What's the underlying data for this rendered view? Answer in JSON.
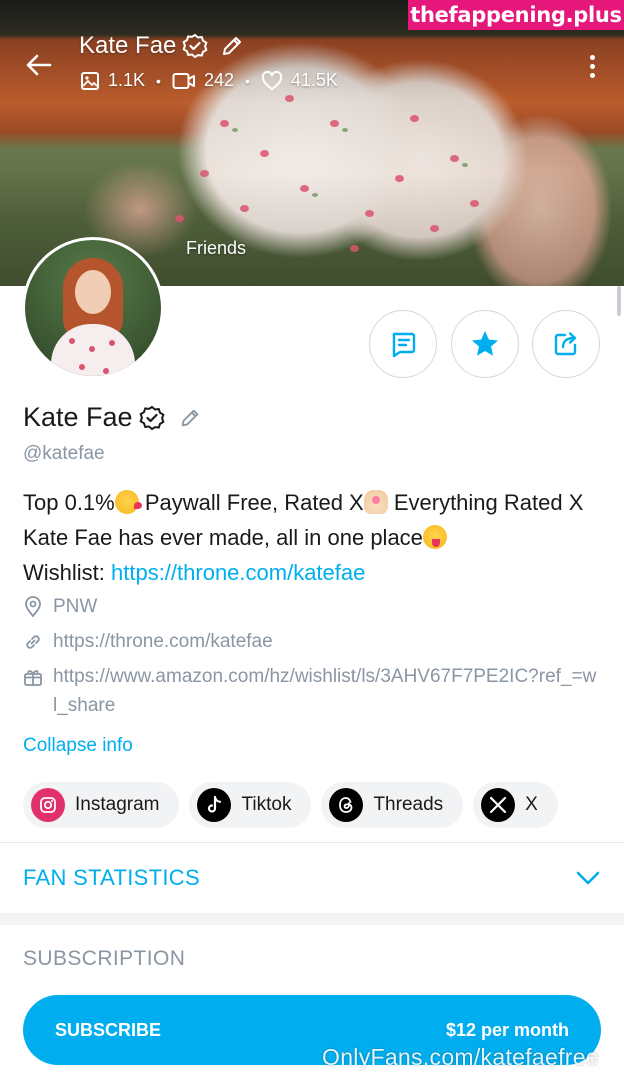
{
  "watermark": {
    "top": "thefappening.plus",
    "bottom": "OnlyFans.com/katefaefree"
  },
  "header": {
    "name": "Kate Fae",
    "stats": [
      {
        "icon": "image-icon",
        "value": "1.1K"
      },
      {
        "icon": "video-icon",
        "value": "242"
      },
      {
        "icon": "heart-icon",
        "value": "41.5K"
      }
    ],
    "cover_label": "Friends"
  },
  "profile": {
    "name": "Kate Fae",
    "handle": "@katefae",
    "bio": {
      "part1": "Top 0.1%",
      "part2": " Paywall Free, Rated X",
      "part3": " Everything Rated X Kate Fae has ever made, all in one place",
      "wishlist_label": "Wishlist: ",
      "wishlist_link": "https://throne.com/katefae"
    },
    "location": "PNW",
    "website": "https://throne.com/katefae",
    "amazon": "https://www.amazon.com/hz/wishlist/ls/3AHV67F7PE2IC?ref_=wl_share",
    "collapse_label": "Collapse info"
  },
  "socials": [
    {
      "label": "Instagram",
      "icon": "instagram-icon"
    },
    {
      "label": "Tiktok",
      "icon": "tiktok-icon"
    },
    {
      "label": "Threads",
      "icon": "threads-icon"
    },
    {
      "label": "X",
      "icon": "x-icon"
    }
  ],
  "fan_statistics": {
    "label": "FAN STATISTICS"
  },
  "subscription": {
    "title": "SUBSCRIPTION",
    "button_label": "SUBSCRIBE",
    "price": "$12 per month"
  },
  "colors": {
    "accent": "#00aeef",
    "muted": "#8a96a3",
    "watermark": "#e5177b"
  }
}
